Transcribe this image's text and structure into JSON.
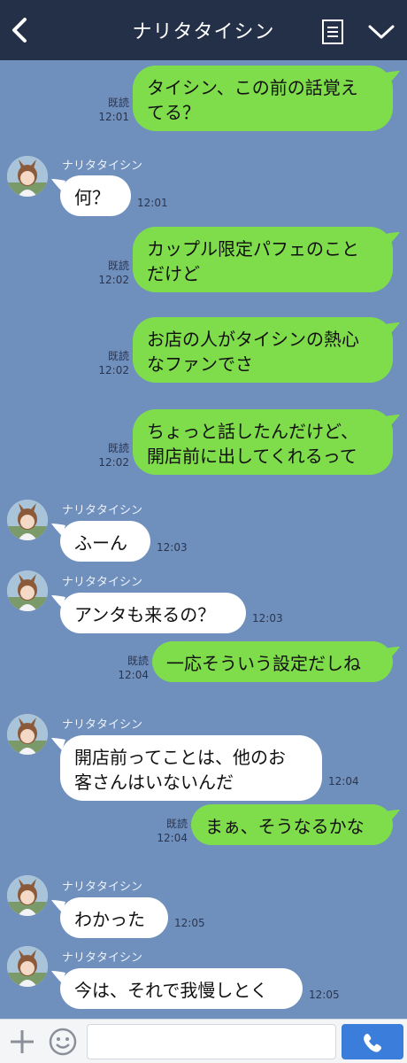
{
  "header": {
    "title": "ナリタタイシン",
    "icons": [
      "back-chevron-icon",
      "notes-menu-icon",
      "chevron-down-icon"
    ]
  },
  "contact": {
    "name": "ナリタタイシン"
  },
  "messages": [
    {
      "side": "right",
      "lines": [
        "タイシン、この前の話覚え",
        "てる？"
      ],
      "read": "既読",
      "time": "12:01"
    },
    {
      "side": "left",
      "lines": [
        "何？"
      ],
      "time": "12:01"
    },
    {
      "side": "right",
      "lines": [
        "カップル限定パフェのこと",
        "だけど"
      ],
      "read": "既読",
      "time": "12:02"
    },
    {
      "side": "right",
      "lines": [
        "お店の人がタイシンの熱心",
        "なファンでさ"
      ],
      "read": "既読",
      "time": "12:02"
    },
    {
      "side": "right",
      "lines": [
        "ちょっと話したんだけど、",
        "開店前に出してくれるって"
      ],
      "read": "既読",
      "time": "12:02"
    },
    {
      "side": "left",
      "lines": [
        "ふーん"
      ],
      "time": "12:03"
    },
    {
      "side": "left",
      "lines": [
        "アンタも来るの？"
      ],
      "time": "12:03"
    },
    {
      "side": "right",
      "lines": [
        "一応そういう設定だしね"
      ],
      "read": "既読",
      "time": "12:04"
    },
    {
      "side": "left",
      "lines": [
        "開店前ってことは、他のお",
        "客さんはいないんだ"
      ],
      "time": "12:04"
    },
    {
      "side": "right",
      "lines": [
        "まぁ、そうなるかな"
      ],
      "read": "既読",
      "time": "12:04"
    },
    {
      "side": "left",
      "lines": [
        "わかった"
      ],
      "time": "12:05"
    },
    {
      "side": "left",
      "lines": [
        "今は、それで我慢しとく"
      ],
      "time": "12:05"
    }
  ],
  "footer": {
    "input_value": "",
    "icons": [
      "plus-icon",
      "emoji-icon",
      "phone-icon"
    ]
  },
  "colors": {
    "background": "#6f8fbd",
    "header": "#233048",
    "outgoing_bubble": "#7fdd4c",
    "incoming_bubble": "#ffffff",
    "call_button": "#3b7ddb"
  }
}
